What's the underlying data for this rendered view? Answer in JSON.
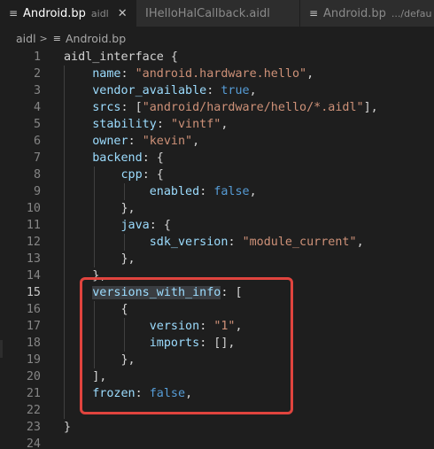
{
  "tabs": [
    {
      "icon": "≡",
      "label": "Android.bp",
      "description": "aidl",
      "close": "✕",
      "active": true
    },
    {
      "icon": "",
      "label": "IHelloHalCallback.aidl",
      "description": "",
      "close": "",
      "active": false
    },
    {
      "icon": "≡",
      "label": "Android.bp",
      "description": ".../defau",
      "close": "",
      "active": false
    }
  ],
  "breadcrumb": {
    "folder": "aidl",
    "separator": ">",
    "file_icon": "≡",
    "file": "Android.bp"
  },
  "editor": {
    "current_line": 15,
    "line_numbers": [
      "1",
      "2",
      "3",
      "4",
      "5",
      "6",
      "7",
      "8",
      "9",
      "10",
      "11",
      "12",
      "13",
      "14",
      "15",
      "16",
      "17",
      "18",
      "19",
      "20",
      "21",
      "22",
      "23",
      "24"
    ],
    "lines": [
      [
        {
          "t": "aidl_interface",
          "c": "p"
        },
        {
          "t": " {",
          "c": "p"
        }
      ],
      [
        {
          "t": "    name",
          "c": "k"
        },
        {
          "t": ": ",
          "c": "p"
        },
        {
          "t": "\"android.hardware.hello\"",
          "c": "s"
        },
        {
          "t": ",",
          "c": "p"
        }
      ],
      [
        {
          "t": "    vendor_available",
          "c": "k"
        },
        {
          "t": ": ",
          "c": "p"
        },
        {
          "t": "true",
          "c": "b"
        },
        {
          "t": ",",
          "c": "p"
        }
      ],
      [
        {
          "t": "    srcs",
          "c": "k"
        },
        {
          "t": ": [",
          "c": "p"
        },
        {
          "t": "\"android/hardware/hello/*.aidl\"",
          "c": "s"
        },
        {
          "t": "],",
          "c": "p"
        }
      ],
      [
        {
          "t": "    stability",
          "c": "k"
        },
        {
          "t": ": ",
          "c": "p"
        },
        {
          "t": "\"vintf\"",
          "c": "s"
        },
        {
          "t": ",",
          "c": "p"
        }
      ],
      [
        {
          "t": "    owner",
          "c": "k"
        },
        {
          "t": ": ",
          "c": "p"
        },
        {
          "t": "\"kevin\"",
          "c": "s"
        },
        {
          "t": ",",
          "c": "p"
        }
      ],
      [
        {
          "t": "    backend",
          "c": "k"
        },
        {
          "t": ": {",
          "c": "p"
        }
      ],
      [
        {
          "t": "        cpp",
          "c": "k"
        },
        {
          "t": ": {",
          "c": "p"
        }
      ],
      [
        {
          "t": "            enabled",
          "c": "k"
        },
        {
          "t": ": ",
          "c": "p"
        },
        {
          "t": "false",
          "c": "b"
        },
        {
          "t": ",",
          "c": "p"
        }
      ],
      [
        {
          "t": "        },",
          "c": "p"
        }
      ],
      [
        {
          "t": "        java",
          "c": "k"
        },
        {
          "t": ": {",
          "c": "p"
        }
      ],
      [
        {
          "t": "            sdk_version",
          "c": "k"
        },
        {
          "t": ": ",
          "c": "p"
        },
        {
          "t": "\"module_current\"",
          "c": "s"
        },
        {
          "t": ",",
          "c": "p"
        }
      ],
      [
        {
          "t": "        },",
          "c": "p"
        }
      ],
      [
        {
          "t": "    },",
          "c": "p"
        }
      ],
      [
        {
          "t": "    ",
          "c": "p"
        },
        {
          "t": "versions_with_info",
          "c": "k",
          "hl": true
        },
        {
          "t": ": [",
          "c": "p"
        }
      ],
      [
        {
          "t": "        {",
          "c": "p"
        }
      ],
      [
        {
          "t": "            version",
          "c": "k"
        },
        {
          "t": ": ",
          "c": "p"
        },
        {
          "t": "\"1\"",
          "c": "s"
        },
        {
          "t": ",",
          "c": "p"
        }
      ],
      [
        {
          "t": "            imports",
          "c": "k"
        },
        {
          "t": ": [],",
          "c": "p"
        }
      ],
      [
        {
          "t": "        },",
          "c": "p"
        }
      ],
      [
        {
          "t": "    ],",
          "c": "p"
        }
      ],
      [
        {
          "t": "    frozen",
          "c": "k"
        },
        {
          "t": ": ",
          "c": "p"
        },
        {
          "t": "false",
          "c": "b"
        },
        {
          "t": ",",
          "c": "p"
        }
      ],
      [],
      [
        {
          "t": "}",
          "c": "p"
        }
      ],
      []
    ]
  },
  "colors": {
    "background": "#1e1e1e",
    "key": "#9cdcfe",
    "string": "#ce9178",
    "boolean": "#569cd6",
    "annotation": "#e0443e"
  }
}
